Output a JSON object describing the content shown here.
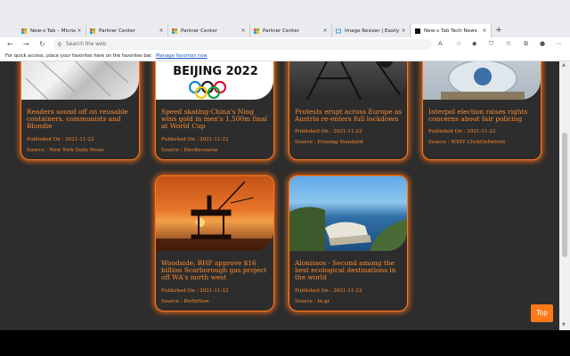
{
  "browser": {
    "tabs": [
      {
        "title": "New-s Tab – Microsoft Edge",
        "active": false
      },
      {
        "title": "Partner Center",
        "active": false
      },
      {
        "title": "Partner Center",
        "active": false
      },
      {
        "title": "Partner Center",
        "active": false
      },
      {
        "title": "Image Resizer | Easily Resize",
        "active": false
      },
      {
        "title": "New-s Tab Tech News",
        "active": true
      }
    ],
    "address_placeholder": "Search the web",
    "favorites_text": "For quick access, place your favorites here on the favorites bar.",
    "favorites_link": "Manage favorites now"
  },
  "articles": [
    {
      "title": "Readers sound off on reusable containers, communists and Blondie",
      "published_label": "Published On : 2021-11-22",
      "source_label": "Source :  New York Daily News"
    },
    {
      "title": "Speed skating-China's Ning wins gold in men's 1,500m final at World Cup",
      "published_label": "Published On : 2021-11-22",
      "source_label": "Source :  Devdiscourse",
      "image_text": "BEIJING 2022"
    },
    {
      "title": "Protests erupt across Europe as Austria re-enters full lockdown",
      "published_label": "Published On : 2021-11-22",
      "source_label": "Source :  Evening Standard"
    },
    {
      "title": "Interpol election raises rights concerns about fair policing",
      "published_label": "Published On : 2021-11-22",
      "source_label": "Source :  WDIV ClickOnDetroit"
    },
    {
      "title": "Woodside, BHP approve $16 billion Scarborough gas project off WA's north west",
      "published_label": "Published On : 2021-11-22",
      "source_label": "Source :  PerthNow"
    },
    {
      "title": "Alonissos - Second among the best ecological destinations in the world",
      "published_label": "Published On : 2021-11-22",
      "source_label": "Source :  In.gr"
    }
  ],
  "top_button": "Top",
  "colors": {
    "accent": "#ff7a1a",
    "page_bg": "#2d2d2d"
  }
}
